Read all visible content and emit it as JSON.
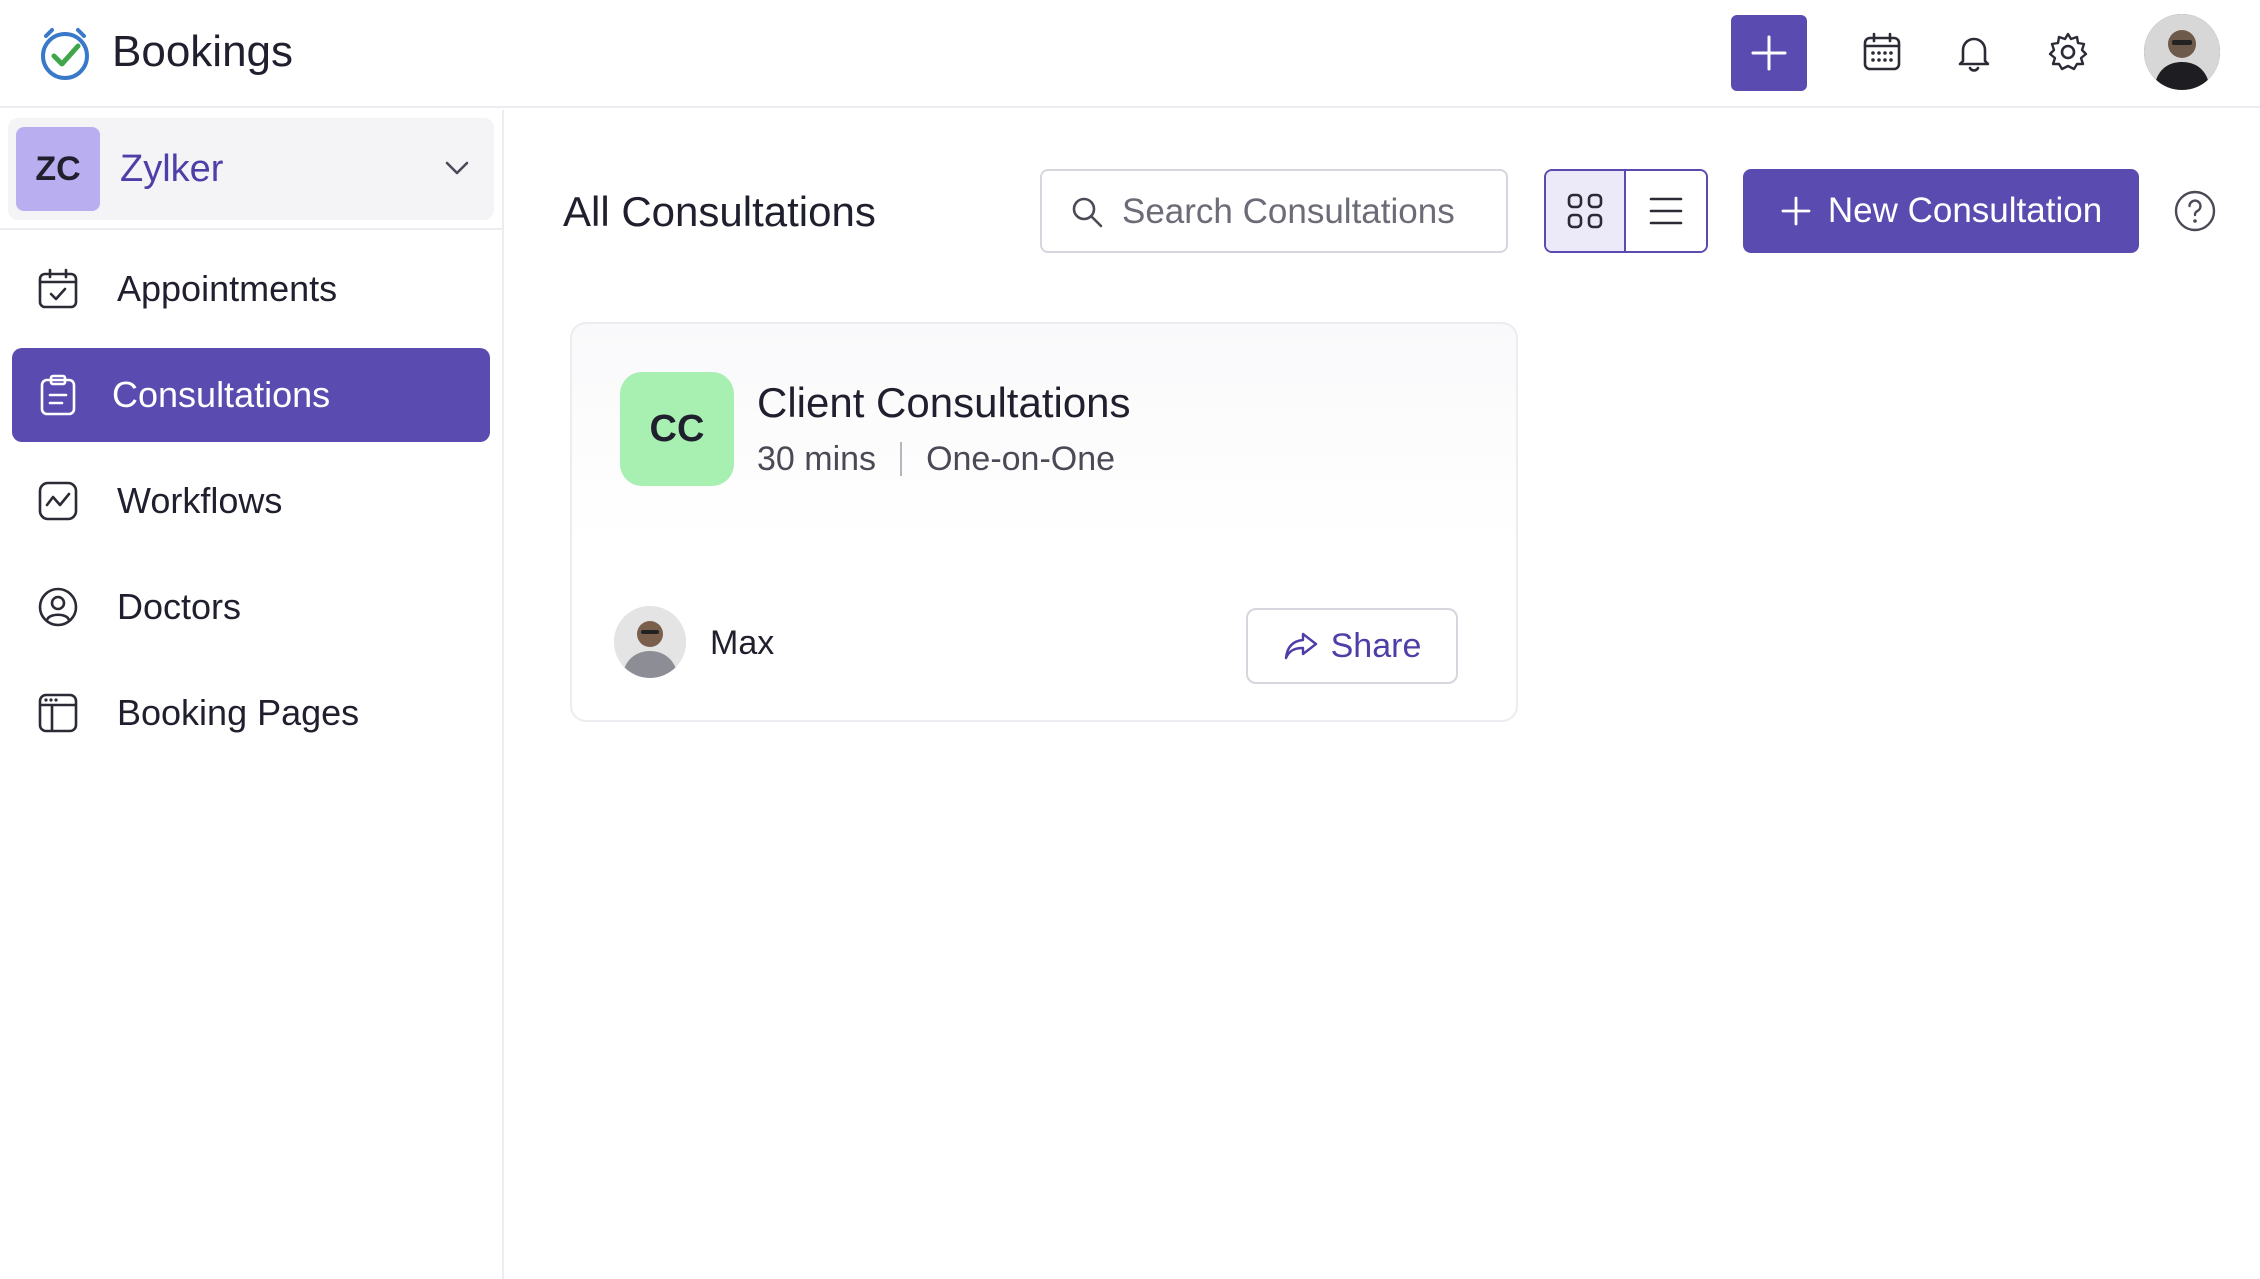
{
  "app": {
    "title": "Bookings"
  },
  "header": {
    "icons": [
      "plus-icon",
      "calendar-icon",
      "bell-icon",
      "gear-icon"
    ],
    "accent": "#5a4bb0"
  },
  "org": {
    "initials": "ZC",
    "name": "Zylker"
  },
  "sidebar": {
    "items": [
      {
        "label": "Appointments",
        "icon": "calendar-check-icon",
        "active": false
      },
      {
        "label": "Consultations",
        "icon": "clipboard-icon",
        "active": true
      },
      {
        "label": "Workflows",
        "icon": "workflow-icon",
        "active": false
      },
      {
        "label": "Doctors",
        "icon": "user-circle-icon",
        "active": false
      },
      {
        "label": "Booking Pages",
        "icon": "booking-page-icon",
        "active": false
      }
    ]
  },
  "main": {
    "title": "All Consultations",
    "search": {
      "placeholder": "Search Consultations",
      "value": ""
    },
    "new_button_label": "New Consultation",
    "view_mode": "grid"
  },
  "cards": [
    {
      "initials": "CC",
      "title": "Client Consultations",
      "duration": "30 mins",
      "type": "One-on-One",
      "host": "Max",
      "share_label": "Share",
      "badge_color": "#a8f0b2"
    }
  ]
}
